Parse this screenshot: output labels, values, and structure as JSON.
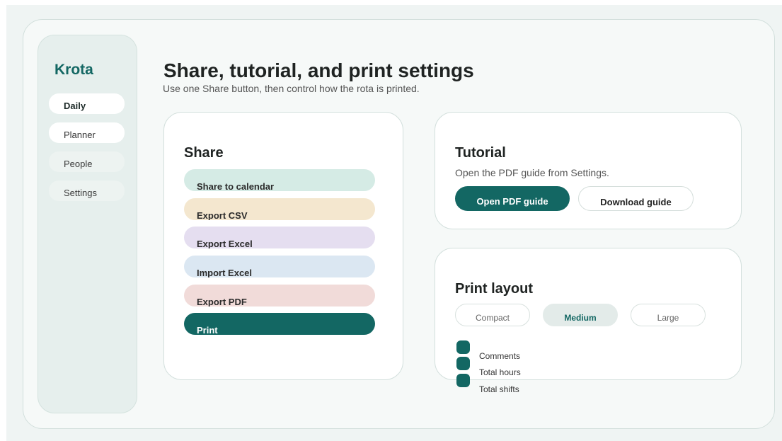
{
  "brand": "Krota",
  "nav": [
    {
      "label": "Daily",
      "active": true
    },
    {
      "label": "Planner",
      "active": false
    },
    {
      "label": "People",
      "active": false
    },
    {
      "label": "Settings",
      "active": false
    }
  ],
  "header": {
    "title": "Share, tutorial, and print settings",
    "subtitle": "Use one Share button, then control how the rota is printed."
  },
  "share": {
    "title": "Share",
    "actions": [
      {
        "label": "Share to calendar",
        "color": "#d5ebe5"
      },
      {
        "label": "Export CSV",
        "color": "#f4e7cf"
      },
      {
        "label": "Export Excel",
        "color": "#e5def0"
      },
      {
        "label": "Import Excel",
        "color": "#dbe7f2"
      },
      {
        "label": "Export PDF",
        "color": "#f1dbd9"
      },
      {
        "label": "Print",
        "color": "#136763"
      }
    ]
  },
  "tutorial": {
    "title": "Tutorial",
    "description": "Open the PDF guide from Settings.",
    "primary_label": "Open PDF guide",
    "secondary_label": "Download guide"
  },
  "print_layout": {
    "title": "Print layout",
    "options": [
      "Compact",
      "Medium",
      "Large"
    ],
    "selected": "Medium",
    "toggles": [
      {
        "label": "Comments",
        "checked": true
      },
      {
        "label": "Total hours",
        "checked": true
      },
      {
        "label": "Total shifts",
        "checked": true
      }
    ]
  },
  "colors": {
    "accent": "#136763",
    "background": "#eff4f3"
  }
}
